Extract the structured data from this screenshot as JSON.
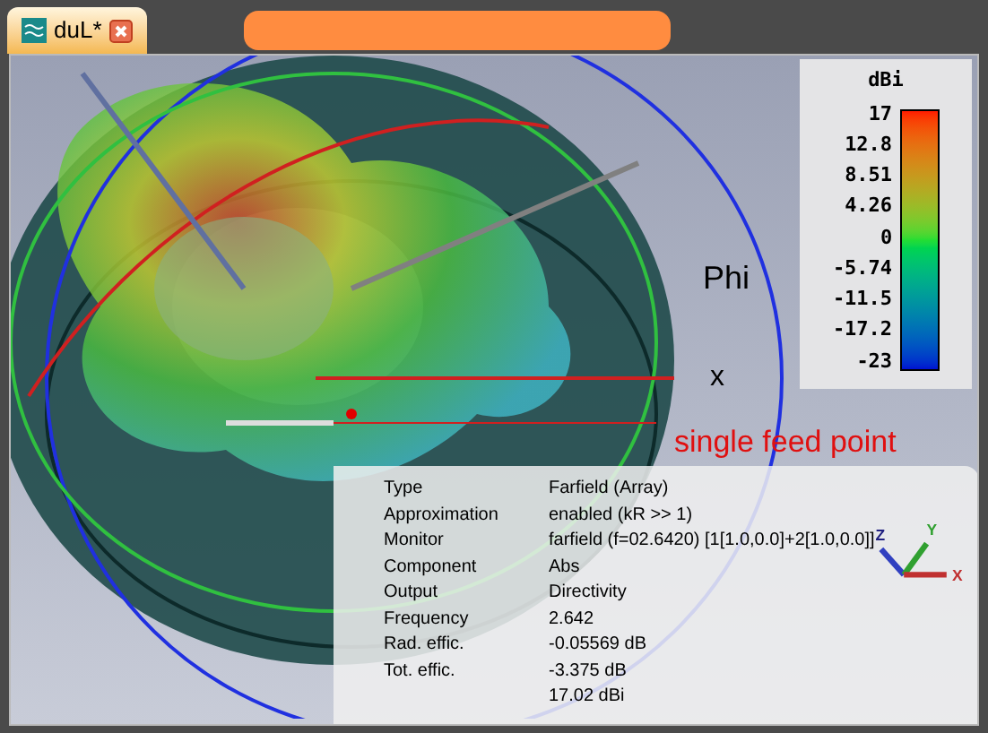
{
  "tab": {
    "label": "duL*",
    "selected": true
  },
  "viewport": {
    "axis_labels": [
      {
        "text": "Phi",
        "kind": "phi"
      },
      {
        "text": "x",
        "kind": "x"
      }
    ],
    "annotation": "single feed point"
  },
  "legend": {
    "unit": "dBi",
    "ticks": [
      "17",
      "12.8",
      "8.51",
      "4.26",
      "0",
      "-5.74",
      "-11.5",
      "-17.2",
      "-23"
    ]
  },
  "info": {
    "rows": [
      {
        "label": "Type",
        "value": "Farfield (Array)"
      },
      {
        "label": "Approximation",
        "value": "enabled (kR >> 1)"
      },
      {
        "label": "Monitor",
        "value": "farfield (f=02.6420) [1[1.0,0.0]+2[1.0,0.0]]"
      },
      {
        "label": "Component",
        "value": "Abs"
      },
      {
        "label": "Output",
        "value": "Directivity"
      },
      {
        "label": "Frequency",
        "value": "2.642"
      },
      {
        "label": "Rad. effic.",
        "value": "-0.05569 dB"
      },
      {
        "label": "Tot. effic.",
        "value": "-3.375 dB"
      },
      {
        "value": "17.02 dBi"
      }
    ],
    "triad_labels": [
      "Z",
      "Y",
      "X"
    ]
  }
}
